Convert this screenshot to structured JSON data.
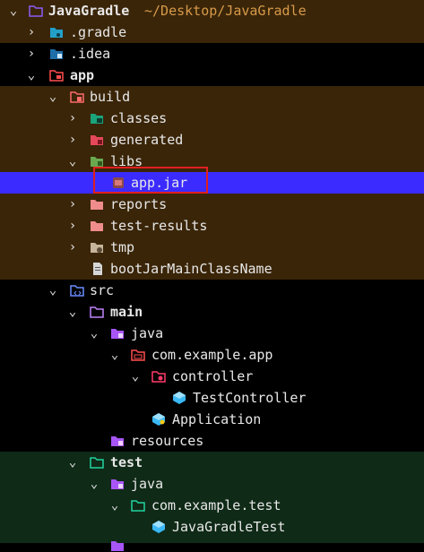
{
  "tree": {
    "root": {
      "label": "JavaGradle",
      "path": "~/Desktop/JavaGradle",
      "icon": "project-folder-icon"
    },
    "items": [
      {
        "label": "JavaGradle",
        "bold": true,
        "icon": "project-folder-icon",
        "chev": "down",
        "bg": "excl"
      },
      {
        "label": ".gradle",
        "icon": "gradle-folder-icon",
        "chev": "right",
        "bg": "excl"
      },
      {
        "label": ".idea",
        "icon": "idea-folder-icon",
        "chev": "right",
        "bg": ""
      },
      {
        "label": "app",
        "bold": true,
        "icon": "module-folder-icon",
        "chev": "down",
        "bg": ""
      },
      {
        "label": "build",
        "icon": "build-folder-icon",
        "chev": "down",
        "bg": "excl"
      },
      {
        "label": "classes",
        "icon": "classes-folder-icon",
        "chev": "right",
        "bg": "excl"
      },
      {
        "label": "generated",
        "icon": "generated-folder-icon",
        "chev": "right",
        "bg": "excl"
      },
      {
        "label": "libs",
        "icon": "libs-folder-icon",
        "chev": "down",
        "bg": "excl"
      },
      {
        "label": "app.jar",
        "icon": "jar-file-icon",
        "chev": "",
        "bg": "sel"
      },
      {
        "label": "reports",
        "icon": "folder-icon",
        "chev": "right",
        "bg": "excl"
      },
      {
        "label": "test-results",
        "icon": "folder-icon",
        "chev": "right",
        "bg": "excl"
      },
      {
        "label": "tmp",
        "icon": "tmp-folder-icon",
        "chev": "right",
        "bg": "excl"
      },
      {
        "label": "bootJarMainClassName",
        "icon": "file-icon",
        "chev": "",
        "bg": "excl"
      },
      {
        "label": "src",
        "icon": "src-folder-icon",
        "chev": "down",
        "bg": ""
      },
      {
        "label": "main",
        "bold": true,
        "icon": "folder-outline-icon",
        "chev": "down",
        "bg": ""
      },
      {
        "label": "java",
        "icon": "java-source-folder-icon",
        "chev": "down",
        "bg": ""
      },
      {
        "label": "com.example.app",
        "icon": "package-icon",
        "chev": "down",
        "bg": ""
      },
      {
        "label": "controller",
        "icon": "controller-package-icon",
        "chev": "down",
        "bg": ""
      },
      {
        "label": "TestController",
        "icon": "java-class-icon",
        "chev": "",
        "bg": ""
      },
      {
        "label": "Application",
        "icon": "java-app-class-icon",
        "chev": "",
        "bg": ""
      },
      {
        "label": "resources",
        "icon": "resources-folder-icon",
        "chev": "",
        "bg": ""
      },
      {
        "label": "test",
        "bold": true,
        "icon": "test-folder-icon",
        "chev": "down",
        "bg": "testbg"
      },
      {
        "label": "java",
        "icon": "java-source-folder-icon",
        "chev": "down",
        "bg": "testbg"
      },
      {
        "label": "com.example.test",
        "icon": "test-package-icon",
        "chev": "down",
        "bg": "testbg"
      },
      {
        "label": "JavaGradleTest",
        "icon": "java-class-icon",
        "chev": "",
        "bg": "testbg"
      }
    ]
  },
  "colors": {
    "excluded_bg": "#3a2508",
    "test_bg": "#0f2a17",
    "selection_bg": "#3b2bff",
    "highlight_border": "#e01f1f"
  }
}
